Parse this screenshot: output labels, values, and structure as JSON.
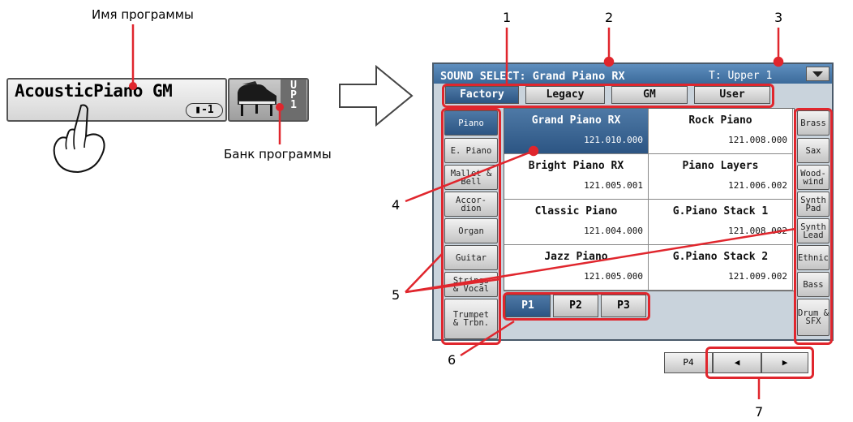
{
  "captions": {
    "program_name": "Имя программы",
    "program_bank": "Банк программы"
  },
  "program_box": {
    "name": "AcousticPiano GM",
    "transpose": "▮-1",
    "bank_tag": "UP1",
    "instrument_icon": "grand-piano-icon"
  },
  "callouts": [
    "1",
    "2",
    "3",
    "4",
    "5",
    "6",
    "7"
  ],
  "screen": {
    "title": "SOUND SELECT: Grand Piano RX",
    "track": "T: Upper 1",
    "menu_icon": "dropdown-arrow-icon",
    "bank_tabs": [
      {
        "label": "Factory",
        "selected": true
      },
      {
        "label": "Legacy",
        "selected": false
      },
      {
        "label": "GM",
        "selected": false
      },
      {
        "label": "User",
        "selected": false
      }
    ],
    "left_categories": [
      {
        "label": "Piano",
        "selected": true
      },
      {
        "label": "E. Piano",
        "selected": false
      },
      {
        "label": "Mallet &\nBell",
        "selected": false
      },
      {
        "label": "Accor-\ndion",
        "selected": false
      },
      {
        "label": "Organ",
        "selected": false
      },
      {
        "label": "Guitar",
        "selected": false
      },
      {
        "label": "Strings\n& Vocal",
        "selected": false
      },
      {
        "label": "Trumpet\n& Trbn.",
        "selected": false
      }
    ],
    "right_categories": [
      {
        "label": "Brass"
      },
      {
        "label": "Sax"
      },
      {
        "label": "Wood-\nwind"
      },
      {
        "label": "Synth\nPad"
      },
      {
        "label": "Synth\nLead"
      },
      {
        "label": "Ethnic"
      },
      {
        "label": "Bass"
      },
      {
        "label": "Drum &\nSFX"
      }
    ],
    "sounds": [
      {
        "name": "Grand Piano RX",
        "code": "121.010.000",
        "selected": true
      },
      {
        "name": "Rock Piano",
        "code": "121.008.000",
        "selected": false
      },
      {
        "name": "Bright Piano RX",
        "code": "121.005.001",
        "selected": false
      },
      {
        "name": "Piano Layers",
        "code": "121.006.002",
        "selected": false
      },
      {
        "name": "Classic Piano",
        "code": "121.004.000",
        "selected": false
      },
      {
        "name": "G.Piano Stack 1",
        "code": "121.008.002",
        "selected": false
      },
      {
        "name": "Jazz Piano",
        "code": "121.005.000",
        "selected": false
      },
      {
        "name": "G.Piano Stack 2",
        "code": "121.009.002",
        "selected": false
      }
    ],
    "pages": [
      {
        "label": "P1",
        "selected": true
      },
      {
        "label": "P2",
        "selected": false
      },
      {
        "label": "P3",
        "selected": false
      }
    ]
  },
  "bottom_controls": {
    "page_button": "P4",
    "prev_icon": "left-arrow-icon",
    "next_icon": "right-arrow-icon",
    "prev_glyph": "◀",
    "next_glyph": "▶"
  },
  "colors": {
    "callout_red": "#e0262d",
    "selected_blue": "#3b6a9a"
  }
}
